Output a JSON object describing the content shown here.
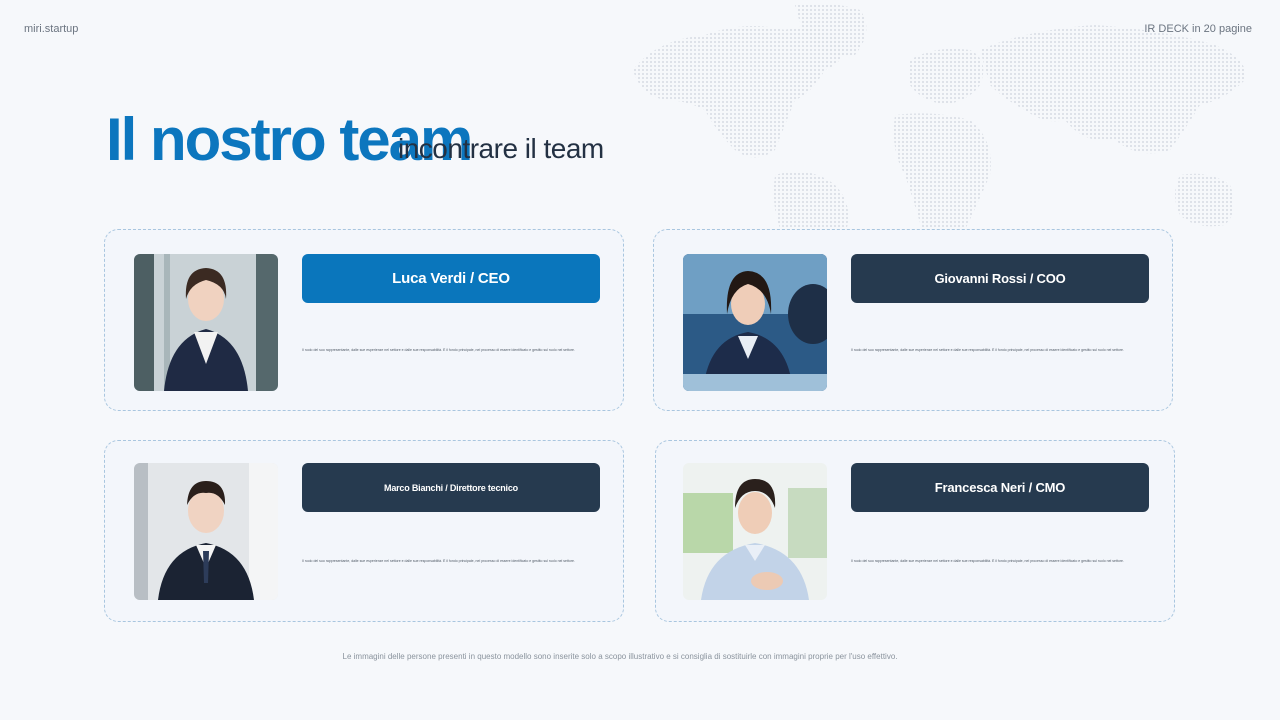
{
  "header": {
    "brand": "miri.startup",
    "deck_tag": "IR DECK in 20 pagine"
  },
  "title": "Il nostro team",
  "subtitle": "incontrare il team",
  "members": [
    {
      "name_role": "Luca Verdi / CEO",
      "description": "Il ruolo del suo rappresentante, dalle sue esperienze nel settore e dalle sue responsabilità. È il fondo principale, nel processo di essere identificato e gestito sul ruolo nel settore.",
      "photo": "woman-business-portrait"
    },
    {
      "name_role": "Giovanni Rossi / COO",
      "description": "Il ruolo del suo rappresentante, dalle sue esperienze nel settore e dalle sue responsabilità. È il fondo principale, nel processo di essere identificato e gestito sul ruolo nel settore.",
      "photo": "woman-meeting-portrait"
    },
    {
      "name_role": "Marco Bianchi / Direttore tecnico",
      "description": "Il ruolo del suo rappresentante, dalle sue esperienze nel settore e dalle sue responsabilità. È il fondo principale, nel processo di essere identificato e gestito sul ruolo nel settore.",
      "photo": "man-suit-portrait"
    },
    {
      "name_role": "Francesca Neri / CMO",
      "description": "Il ruolo del suo rappresentante, dalle sue esperienze nel settore e dalle sue responsabilità. È il fondo principale, nel processo di essere identificato e gestito sul ruolo nel settore.",
      "photo": "man-casual-portrait"
    }
  ],
  "footnote": "Le immagini delle persone presenti in questo modello sono inserite solo a scopo illustrativo e si consiglia di sostituirle con immagini proprie per l'uso effettivo.",
  "colors": {
    "accent": "#0a76bc",
    "dark": "#263a4f",
    "background": "#f6f8fb"
  }
}
